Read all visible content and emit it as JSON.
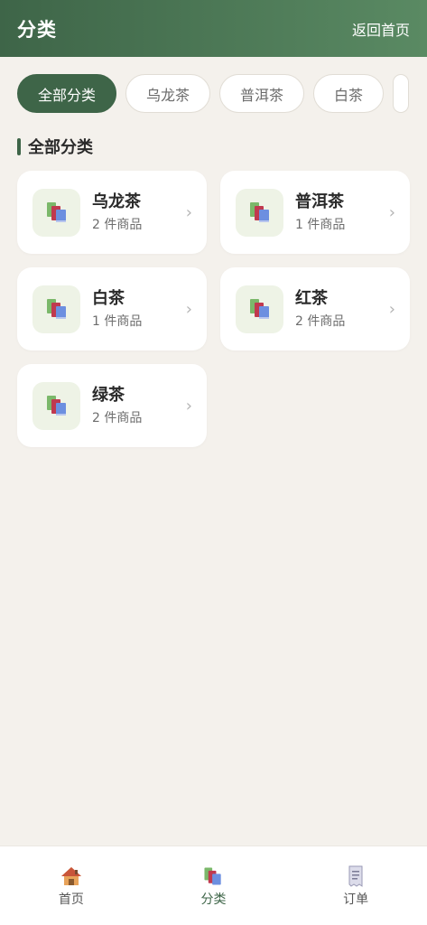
{
  "header": {
    "title": "分类",
    "back_label": "返回首页"
  },
  "chips": [
    {
      "label": "全部分类"
    },
    {
      "label": "乌龙茶"
    },
    {
      "label": "普洱茶"
    },
    {
      "label": "白茶"
    }
  ],
  "section": {
    "title": "全部分类"
  },
  "categories": [
    {
      "name": "乌龙茶",
      "count": "2 件商品"
    },
    {
      "name": "普洱茶",
      "count": "1 件商品"
    },
    {
      "name": "白茶",
      "count": "1 件商品"
    },
    {
      "name": "红茶",
      "count": "2 件商品"
    },
    {
      "name": "绿茶",
      "count": "2 件商品"
    }
  ],
  "nav": [
    {
      "label": "首页",
      "icon": "house-icon"
    },
    {
      "label": "分类",
      "icon": "books-icon"
    },
    {
      "label": "订单",
      "icon": "receipt-icon"
    }
  ],
  "colors": {
    "accent": "#3e6548",
    "background": "#f4f1ec"
  }
}
